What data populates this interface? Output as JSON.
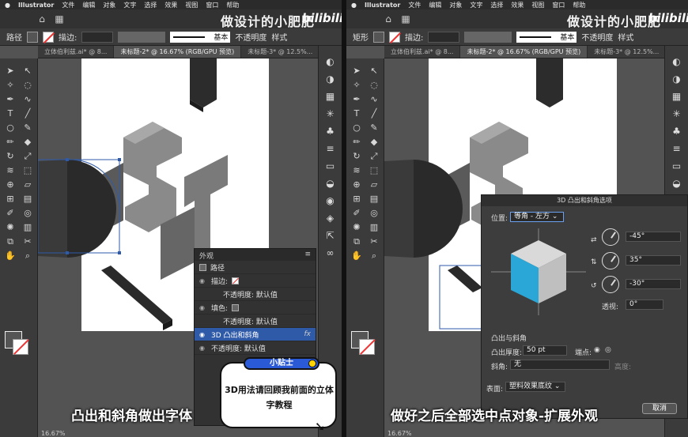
{
  "left": {
    "menubar": {
      "app": "Illustrator",
      "items": [
        "文件",
        "编辑",
        "对象",
        "文字",
        "选择",
        "效果",
        "视图",
        "窗口",
        "帮助"
      ]
    },
    "brand": "做设计的小肥肥",
    "brand_logo": "bilibili",
    "control": {
      "object_type": "路径",
      "stroke_label": "描边:",
      "style_label": "基本",
      "opacity_label": "不透明度",
      "style2": "样式"
    },
    "tabs": [
      "立体伯利兹.ai* @ 8...",
      "未标题-2* @ 16.67% (RGB/GPU 预览)",
      "未标题-3* @ 12.5%..."
    ],
    "appearance": {
      "title": "外观",
      "rows": [
        {
          "label": "路径"
        },
        {
          "label": "描边:"
        },
        {
          "label": "不透明度: 默认值"
        },
        {
          "label": "填色:"
        },
        {
          "label": "不透明度: 默认值"
        },
        {
          "label": "3D 凸出和斜角",
          "fx": "fx"
        },
        {
          "label": "不透明度: 默认值"
        }
      ]
    },
    "zoom": "16.67%",
    "subtitle": "凸出和斜角做出字体",
    "tip": {
      "badge": "小贴士",
      "text": "3D用法请回顾我前面的立体字教程"
    }
  },
  "right": {
    "menubar": {
      "app": "Illustrator",
      "items": [
        "文件",
        "编辑",
        "对象",
        "文字",
        "选择",
        "效果",
        "视图",
        "窗口",
        "帮助"
      ]
    },
    "brand": "做设计的小肥肥",
    "brand_logo": "bilibili",
    "control": {
      "object_type": "矩形",
      "stroke_label": "描边:",
      "style_label": "基本",
      "opacity_label": "不透明度",
      "style2": "样式"
    },
    "tabs": [
      "立体伯利兹.ai* @ 8...",
      "未标题-2* @ 16.67% (RGB/GPU 预览)",
      "未标题-3* @ 12.5%..."
    ],
    "dialog": {
      "title": "3D 凸出和斜角选项",
      "position_label": "位置:",
      "position_value": "等角 - 左方",
      "rot_x": "-45°",
      "rot_y": "35°",
      "rot_z": "-30°",
      "perspective_label": "透视:",
      "perspective_value": "0°",
      "section": "凸出与斜角",
      "depth_label": "凸出厚度:",
      "depth_value": "50 pt",
      "cap_label": "端点:",
      "bevel_label": "斜角:",
      "bevel_value": "无",
      "height_label": "高度:",
      "surface_label": "表面:",
      "surface_value": "塑料效果底纹",
      "cancel": "取消"
    },
    "zoom": "16.67%",
    "subtitle": "做好之后全部选中点对象-扩展外观"
  },
  "colors": {
    "cube_front": "#2aa7d6",
    "cube_top": "#d9d9d9",
    "cube_side": "#bfbfbf",
    "selected_row": "#2f5aa8",
    "badge": "#2b5ad6"
  }
}
